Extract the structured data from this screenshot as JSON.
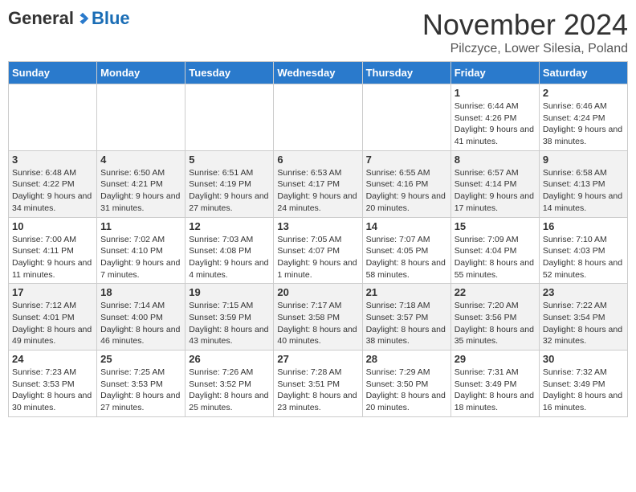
{
  "logo": {
    "general": "General",
    "blue": "Blue"
  },
  "title": "November 2024",
  "location": "Pilczyce, Lower Silesia, Poland",
  "days_header": [
    "Sunday",
    "Monday",
    "Tuesday",
    "Wednesday",
    "Thursday",
    "Friday",
    "Saturday"
  ],
  "weeks": [
    [
      {
        "num": "",
        "info": ""
      },
      {
        "num": "",
        "info": ""
      },
      {
        "num": "",
        "info": ""
      },
      {
        "num": "",
        "info": ""
      },
      {
        "num": "",
        "info": ""
      },
      {
        "num": "1",
        "info": "Sunrise: 6:44 AM\nSunset: 4:26 PM\nDaylight: 9 hours and 41 minutes."
      },
      {
        "num": "2",
        "info": "Sunrise: 6:46 AM\nSunset: 4:24 PM\nDaylight: 9 hours and 38 minutes."
      }
    ],
    [
      {
        "num": "3",
        "info": "Sunrise: 6:48 AM\nSunset: 4:22 PM\nDaylight: 9 hours and 34 minutes."
      },
      {
        "num": "4",
        "info": "Sunrise: 6:50 AM\nSunset: 4:21 PM\nDaylight: 9 hours and 31 minutes."
      },
      {
        "num": "5",
        "info": "Sunrise: 6:51 AM\nSunset: 4:19 PM\nDaylight: 9 hours and 27 minutes."
      },
      {
        "num": "6",
        "info": "Sunrise: 6:53 AM\nSunset: 4:17 PM\nDaylight: 9 hours and 24 minutes."
      },
      {
        "num": "7",
        "info": "Sunrise: 6:55 AM\nSunset: 4:16 PM\nDaylight: 9 hours and 20 minutes."
      },
      {
        "num": "8",
        "info": "Sunrise: 6:57 AM\nSunset: 4:14 PM\nDaylight: 9 hours and 17 minutes."
      },
      {
        "num": "9",
        "info": "Sunrise: 6:58 AM\nSunset: 4:13 PM\nDaylight: 9 hours and 14 minutes."
      }
    ],
    [
      {
        "num": "10",
        "info": "Sunrise: 7:00 AM\nSunset: 4:11 PM\nDaylight: 9 hours and 11 minutes."
      },
      {
        "num": "11",
        "info": "Sunrise: 7:02 AM\nSunset: 4:10 PM\nDaylight: 9 hours and 7 minutes."
      },
      {
        "num": "12",
        "info": "Sunrise: 7:03 AM\nSunset: 4:08 PM\nDaylight: 9 hours and 4 minutes."
      },
      {
        "num": "13",
        "info": "Sunrise: 7:05 AM\nSunset: 4:07 PM\nDaylight: 9 hours and 1 minute."
      },
      {
        "num": "14",
        "info": "Sunrise: 7:07 AM\nSunset: 4:05 PM\nDaylight: 8 hours and 58 minutes."
      },
      {
        "num": "15",
        "info": "Sunrise: 7:09 AM\nSunset: 4:04 PM\nDaylight: 8 hours and 55 minutes."
      },
      {
        "num": "16",
        "info": "Sunrise: 7:10 AM\nSunset: 4:03 PM\nDaylight: 8 hours and 52 minutes."
      }
    ],
    [
      {
        "num": "17",
        "info": "Sunrise: 7:12 AM\nSunset: 4:01 PM\nDaylight: 8 hours and 49 minutes."
      },
      {
        "num": "18",
        "info": "Sunrise: 7:14 AM\nSunset: 4:00 PM\nDaylight: 8 hours and 46 minutes."
      },
      {
        "num": "19",
        "info": "Sunrise: 7:15 AM\nSunset: 3:59 PM\nDaylight: 8 hours and 43 minutes."
      },
      {
        "num": "20",
        "info": "Sunrise: 7:17 AM\nSunset: 3:58 PM\nDaylight: 8 hours and 40 minutes."
      },
      {
        "num": "21",
        "info": "Sunrise: 7:18 AM\nSunset: 3:57 PM\nDaylight: 8 hours and 38 minutes."
      },
      {
        "num": "22",
        "info": "Sunrise: 7:20 AM\nSunset: 3:56 PM\nDaylight: 8 hours and 35 minutes."
      },
      {
        "num": "23",
        "info": "Sunrise: 7:22 AM\nSunset: 3:54 PM\nDaylight: 8 hours and 32 minutes."
      }
    ],
    [
      {
        "num": "24",
        "info": "Sunrise: 7:23 AM\nSunset: 3:53 PM\nDaylight: 8 hours and 30 minutes."
      },
      {
        "num": "25",
        "info": "Sunrise: 7:25 AM\nSunset: 3:53 PM\nDaylight: 8 hours and 27 minutes."
      },
      {
        "num": "26",
        "info": "Sunrise: 7:26 AM\nSunset: 3:52 PM\nDaylight: 8 hours and 25 minutes."
      },
      {
        "num": "27",
        "info": "Sunrise: 7:28 AM\nSunset: 3:51 PM\nDaylight: 8 hours and 23 minutes."
      },
      {
        "num": "28",
        "info": "Sunrise: 7:29 AM\nSunset: 3:50 PM\nDaylight: 8 hours and 20 minutes."
      },
      {
        "num": "29",
        "info": "Sunrise: 7:31 AM\nSunset: 3:49 PM\nDaylight: 8 hours and 18 minutes."
      },
      {
        "num": "30",
        "info": "Sunrise: 7:32 AM\nSunset: 3:49 PM\nDaylight: 8 hours and 16 minutes."
      }
    ]
  ]
}
